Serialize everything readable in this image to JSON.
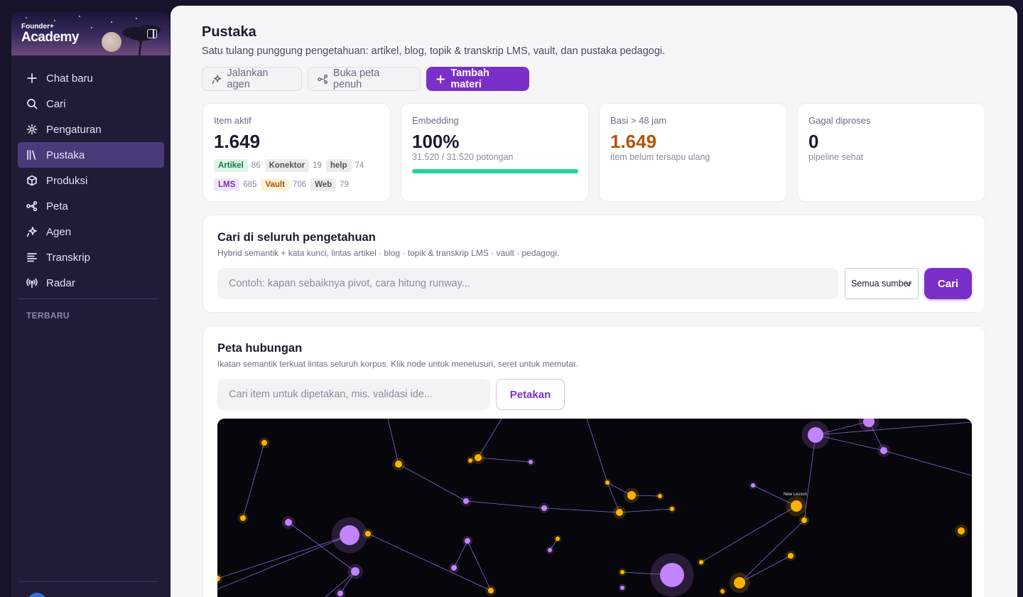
{
  "brand": {
    "small": "Founder+",
    "name": "Academy"
  },
  "sidebar": {
    "items": [
      {
        "label": "Chat baru",
        "icon": "plus-icon"
      },
      {
        "label": "Cari",
        "icon": "search-icon"
      },
      {
        "label": "Pengaturan",
        "icon": "gear-icon"
      },
      {
        "label": "Pustaka",
        "icon": "library-icon",
        "active": true
      },
      {
        "label": "Produksi",
        "icon": "box-icon"
      },
      {
        "label": "Peta",
        "icon": "network-icon"
      },
      {
        "label": "Agen",
        "icon": "sparkle-icon"
      },
      {
        "label": "Transkrip",
        "icon": "lines-icon"
      },
      {
        "label": "Radar",
        "icon": "radio-icon"
      }
    ],
    "recent_title": "TERBARU"
  },
  "page": {
    "title": "Pustaka",
    "subtitle": "Satu tulang punggung pengetahuan: artikel, blog, topik & transkrip LMS, vault, dan pustaka pedagogi."
  },
  "actions": {
    "run_agent": "Jalankan agen",
    "open_map": "Buka peta penuh",
    "add_material": "Tambah materi"
  },
  "stats": {
    "active": {
      "label": "Item aktif",
      "value": "1.649",
      "chips": [
        {
          "label": "Artikel",
          "count": "86",
          "bg": "#dcf5e8",
          "fg": "#137a45"
        },
        {
          "label": "Konektor",
          "count": "19",
          "bg": "#ececec",
          "fg": "#555555"
        },
        {
          "label": "help",
          "count": "74",
          "bg": "#ececec",
          "fg": "#555555"
        },
        {
          "label": "LMS",
          "count": "685",
          "bg": "#f1e6fb",
          "fg": "#7a2fb8"
        },
        {
          "label": "Vault",
          "count": "706",
          "bg": "#fdf1dc",
          "fg": "#a0560a"
        },
        {
          "label": "Web",
          "count": "79",
          "bg": "#ececec",
          "fg": "#555555"
        }
      ]
    },
    "embedding": {
      "label": "Embedding",
      "value": "100%",
      "note": "31.520 / 31.520 potongan",
      "progress": 1.0,
      "progress_color": "#22d49a"
    },
    "stale": {
      "label": "Basi > 48 jam",
      "value": "1.649",
      "note": "item belum tersapu ulang",
      "value_color": "#b5540a"
    },
    "failed": {
      "label": "Gagal diproses",
      "value": "0",
      "note": "pipeline sehat"
    }
  },
  "search": {
    "title": "Cari di seluruh pengetahuan",
    "subtitle": "Hybrid semantik + kata kunci, lintas artikel · blog · topik & transkrip LMS · vault · pedagogi.",
    "placeholder": "Contoh: kapan sebaiknya pivot, cara hitung runway...",
    "source_select": "Semua sumber",
    "button": "Cari"
  },
  "map": {
    "title": "Peta hubungan",
    "subtitle": "Ikatan semantik terkuat lintas seluruh korpus. Klik node untuk menelusuri, seret untuk memutar.",
    "placeholder": "Cari item untuk dipetakan, mis. validasi ide...",
    "button": "Petakan",
    "node_label": "New Lesson",
    "colors": {
      "vault": "#ffb300",
      "lms": "#c084fc",
      "edge": "#8b7cf0"
    }
  }
}
